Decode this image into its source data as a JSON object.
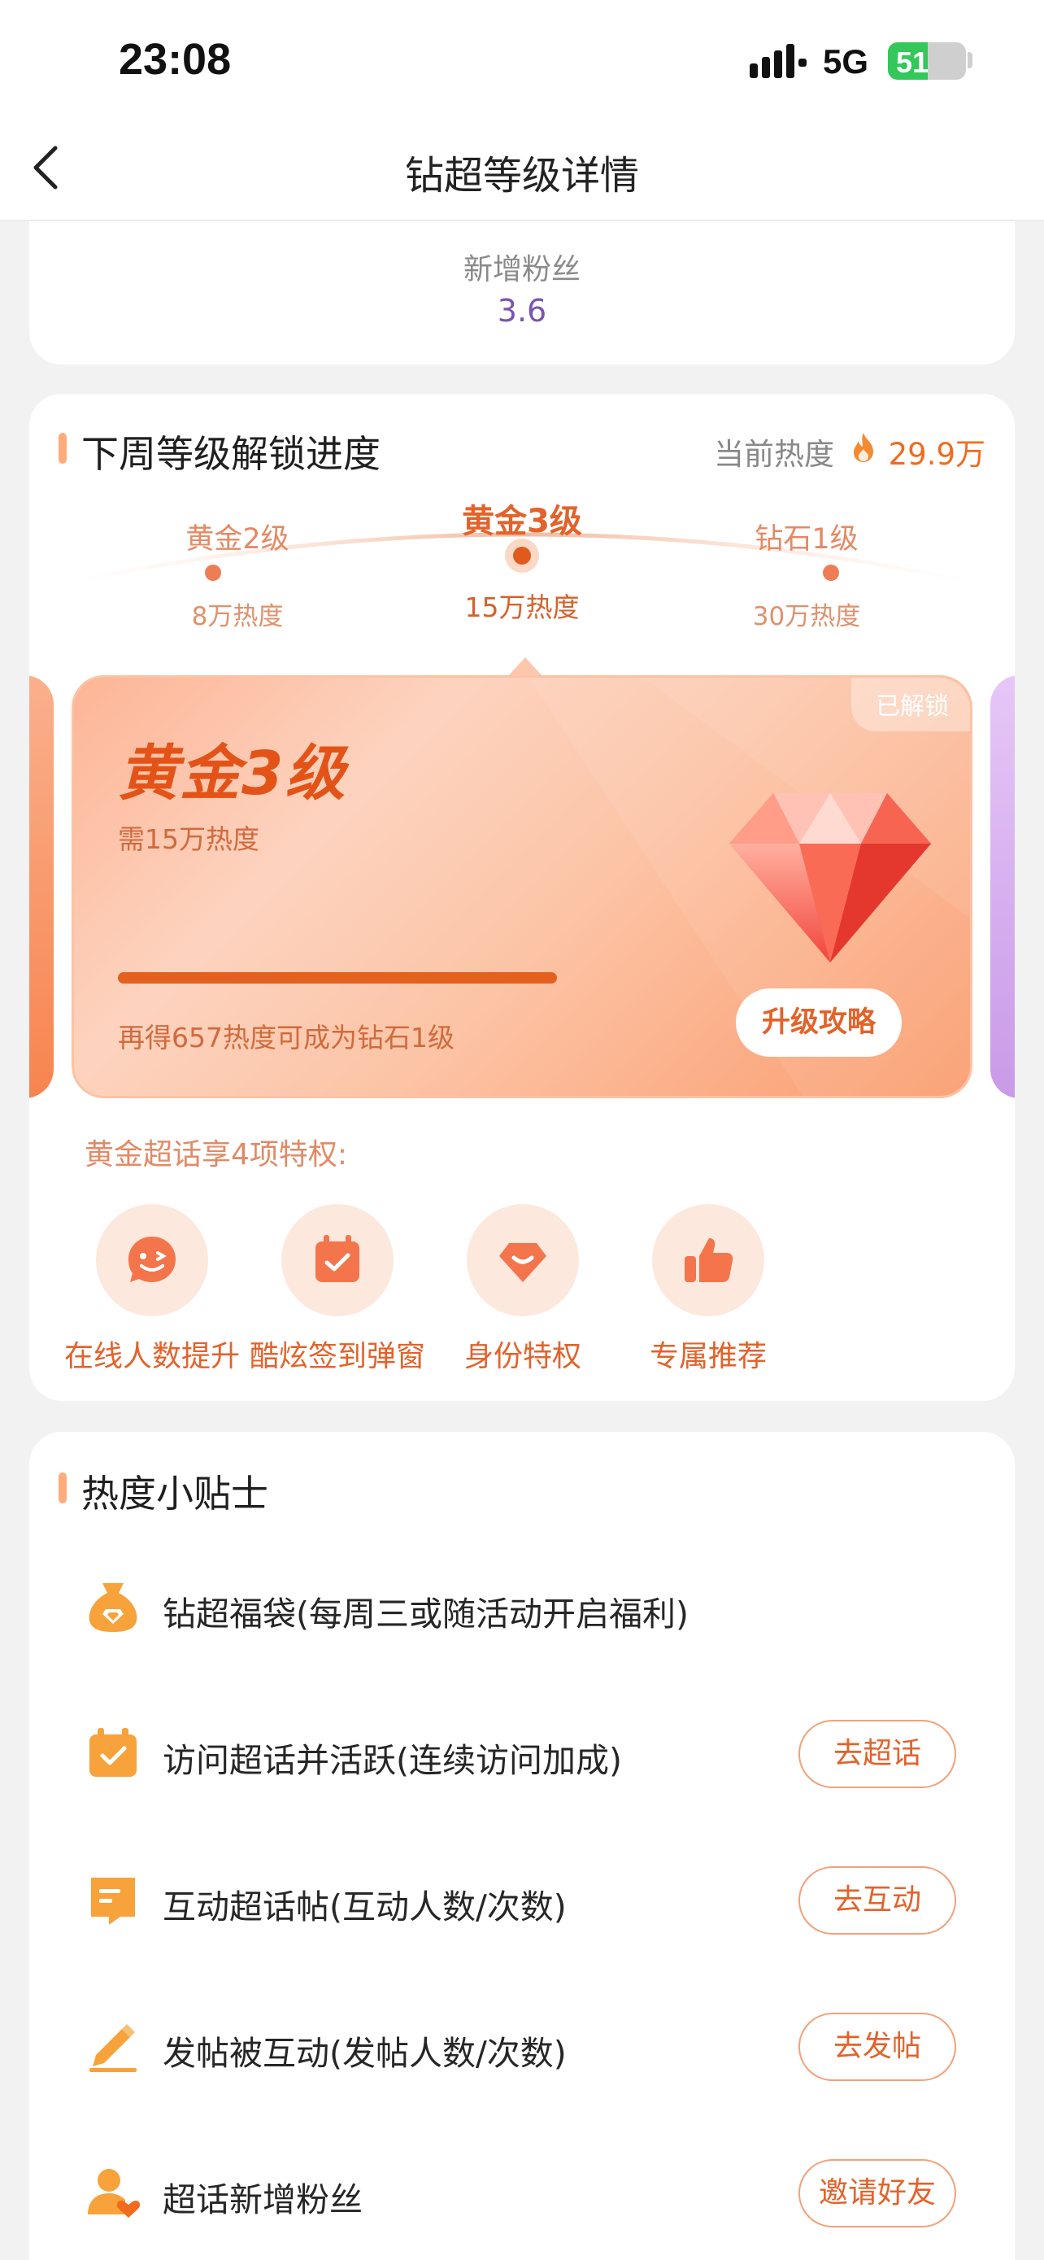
{
  "status_bar": {
    "time": "23:08",
    "network": "5G",
    "battery": "51",
    "battery_level": 0.51
  },
  "nav": {
    "title": "钻超等级详情",
    "back_icon": "chevron-left-icon"
  },
  "summary": {
    "label": "新增粉丝",
    "value": "3.6"
  },
  "level_section": {
    "title": "下周等级解锁进度",
    "current_heat_label": "当前热度",
    "current_heat_value": "29.9万",
    "timeline": [
      {
        "name": "黄金2级",
        "heat": "8万热度"
      },
      {
        "name": "黄金3级",
        "heat": "15万热度",
        "current": true
      },
      {
        "name": "钻石1级",
        "heat": "30万热度"
      }
    ],
    "card": {
      "badge": "已解锁",
      "name": "黄金3级",
      "requirement": "需15万热度",
      "progress": 1.0,
      "remaining": "再得657热度可成为钻石1级",
      "upgrade_button": "升级攻略"
    },
    "perks_title": "黄金超话享4项特权:",
    "perks": [
      {
        "label": "在线人数提升",
        "icon": "smile-chat-icon"
      },
      {
        "label": "酷炫签到弹窗",
        "icon": "calendar-check-icon"
      },
      {
        "label": "身份特权",
        "icon": "gem-badge-icon"
      },
      {
        "label": "专属推荐",
        "icon": "thumbs-up-icon"
      }
    ]
  },
  "tips_section": {
    "title": "热度小贴士",
    "items": [
      {
        "text": "钻超福袋(每周三或随活动开启福利)",
        "icon": "lucky-bag-icon",
        "button": null
      },
      {
        "text": "访问超话并活跃(连续访问加成)",
        "icon": "calendar-check-icon",
        "button": "去超话"
      },
      {
        "text": "互动超话帖(互动人数/次数)",
        "icon": "bookmark-note-icon",
        "button": "去互动"
      },
      {
        "text": "发帖被互动(发帖人数/次数)",
        "icon": "pencil-icon",
        "button": "去发帖"
      },
      {
        "text": "超话新增粉丝",
        "icon": "user-heart-icon",
        "button": "邀请好友"
      }
    ]
  },
  "colors": {
    "accent": "#e3622a",
    "heat_value": "#f26b1d",
    "fans_value": "#7a54b0",
    "background": "#f2f2f2"
  }
}
